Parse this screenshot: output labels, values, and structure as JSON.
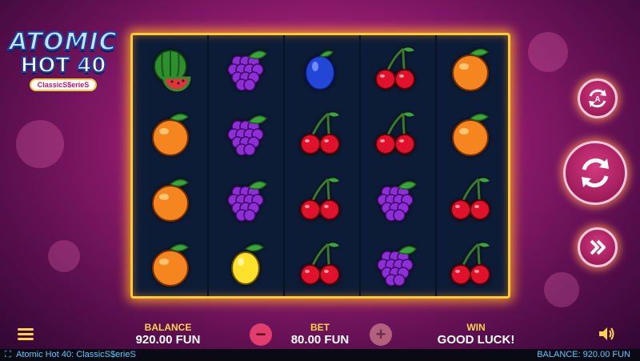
{
  "logo": {
    "line1": "ATOMIC",
    "line2": "HOT 40",
    "line3": "ClassicS$erieS"
  },
  "reels": [
    [
      "watermelon",
      "grapes",
      "plum",
      "cherries",
      "orange"
    ],
    [
      "orange",
      "grapes",
      "cherries",
      "cherries",
      "orange"
    ],
    [
      "orange",
      "grapes",
      "cherries",
      "grapes",
      "cherries"
    ],
    [
      "orange",
      "lemon",
      "cherries",
      "grapes",
      "cherries"
    ]
  ],
  "controls": {
    "autoplay_icon": "autoplay-icon",
    "spin_icon": "spin-icon",
    "turbo_icon": "turbo-icon",
    "menu_icon": "menu-icon",
    "sound_icon": "sound-icon"
  },
  "bottom": {
    "balance_label": "BALANCE",
    "balance_value": "920.00 FUN",
    "bet_label": "BET",
    "bet_value": "80.00 FUN",
    "win_label": "WIN",
    "win_value": "GOOD LUCK!",
    "minus": "−",
    "plus": "+"
  },
  "status": {
    "title": "Atomic Hot 40: ClassicS$erieS",
    "balance": "BALANCE: 920.00 FUN"
  },
  "colors": {
    "frame": "#ffcc33",
    "accent": "#ffd24a",
    "status_text": "#5fc8ff"
  }
}
